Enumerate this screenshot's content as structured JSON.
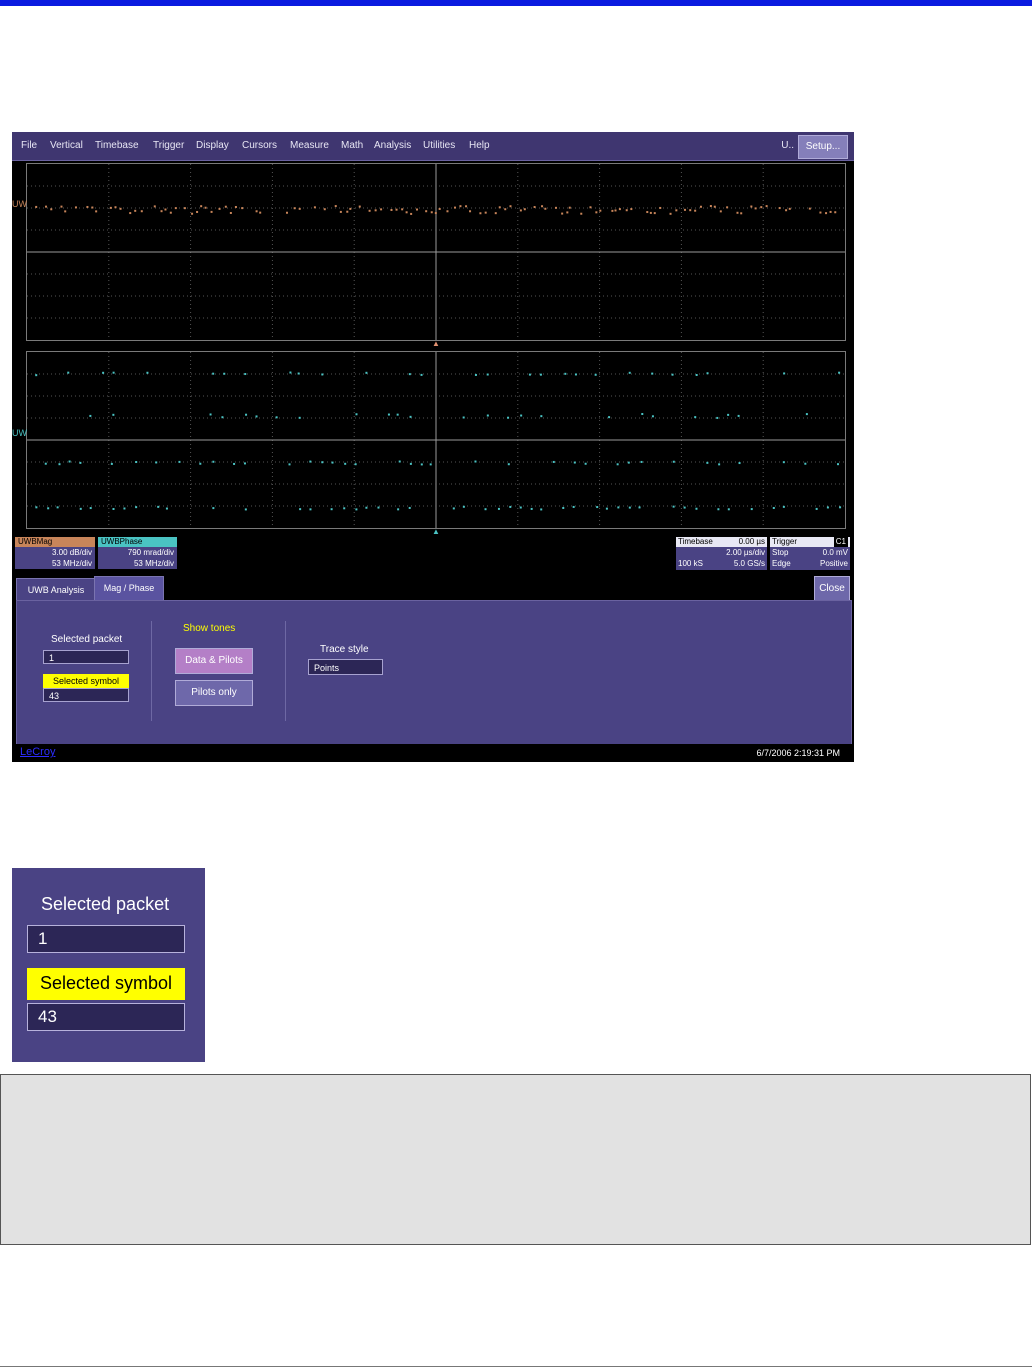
{
  "menu": {
    "items": [
      "File",
      "Vertical",
      "Timebase",
      "Trigger",
      "Display",
      "Cursors",
      "Measure",
      "Math",
      "Analysis",
      "Utilities",
      "Help"
    ],
    "u_label": "U..",
    "setup_label": "Setup..."
  },
  "traces": {
    "upper_label": "UW",
    "lower_label": "UW"
  },
  "channels": {
    "mag": {
      "name": "UWBMag",
      "scale": "3.00 dB/div",
      "freq": "53 MHz/div",
      "color": "#c8855a"
    },
    "phase": {
      "name": "UWBPhase",
      "scale": "790 mrad/div",
      "freq": "53 MHz/div",
      "color": "#4ac3c3"
    }
  },
  "timebase": {
    "title": "Timebase",
    "delay": "0.00 µs",
    "per_div": "2.00 µs/div",
    "samples": "100 kS",
    "rate": "5.0 GS/s"
  },
  "trigger": {
    "title": "Trigger",
    "source": "C1",
    "mode": "Stop",
    "level": "0.0 mV",
    "type": "Edge",
    "slope": "Positive"
  },
  "tabs": [
    "UWB Analysis",
    "Mag / Phase"
  ],
  "close_label": "Close",
  "panel": {
    "selected_packet_label": "Selected packet",
    "selected_packet_value": "1",
    "selected_symbol_label": "Selected symbol",
    "selected_symbol_value": "43",
    "show_tones_label": "Show tones",
    "data_pilots_label": "Data & Pilots",
    "pilots_only_label": "Pilots only",
    "trace_style_label": "Trace style",
    "trace_style_value": "Points"
  },
  "footer": {
    "brand": "LeCroy",
    "timestamp": "6/7/2006 2:19:31 PM"
  },
  "zoom": {
    "selected_packet_label": "Selected packet",
    "selected_packet_value": "1",
    "selected_symbol_label": "Selected symbol",
    "selected_symbol_value": "43"
  },
  "colors": {
    "accent_yellow": "#ffff00",
    "panel_purple": "#4a4384",
    "menu_purple": "#3f3670",
    "blue_bar": "#0b1be0"
  }
}
